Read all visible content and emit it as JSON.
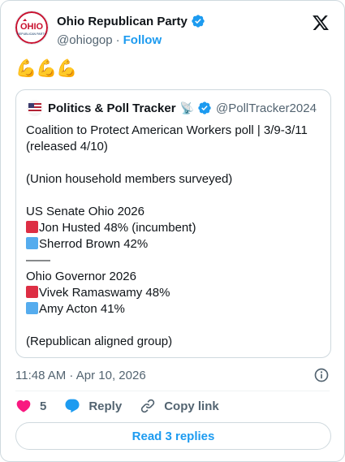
{
  "author": {
    "name": "Ohio Republican Party",
    "handle": "@ohiogop",
    "follow_label": "Follow",
    "avatar_text": "OHIO",
    "avatar_subtext": "REPUBLICAN PARTY"
  },
  "tweet": {
    "emoji_text": "💪💪💪"
  },
  "quote": {
    "name": "Politics & Poll Tracker",
    "emoji": "📡",
    "handle": "@PollTracker2024",
    "lines": [
      {
        "text": "Coalition to Protect American Workers poll | 3/9-3/11"
      },
      {
        "text": "(released 4/10)"
      },
      {
        "text": ""
      },
      {
        "text": "(Union household members surveyed)"
      },
      {
        "text": ""
      },
      {
        "text": "US Senate Ohio 2026"
      },
      {
        "text": "Jon Husted 48% (incumbent)",
        "square": "red"
      },
      {
        "text": "Sherrod Brown 42%",
        "square": "blue"
      },
      {
        "text": "——"
      },
      {
        "text": "Ohio Governor 2026"
      },
      {
        "text": "Vivek Ramaswamy 48%",
        "square": "red"
      },
      {
        "text": "Amy Acton 41%",
        "square": "blue"
      },
      {
        "text": ""
      },
      {
        "text": "(Republican aligned group)"
      }
    ]
  },
  "meta": {
    "timestamp": "11:48 AM · Apr 10, 2026"
  },
  "actions": {
    "like_count": "5",
    "reply_label": "Reply",
    "copy_label": "Copy link"
  },
  "read_replies_label": "Read 3 replies",
  "colors": {
    "accent": "#1d9bf0",
    "like": "#f91880",
    "red_square": "#dd2e44",
    "blue_square": "#55acee"
  }
}
